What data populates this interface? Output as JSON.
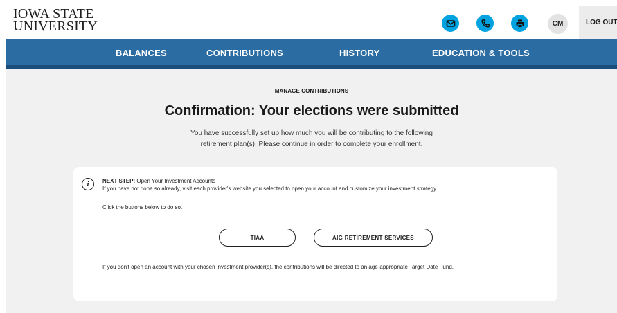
{
  "header": {
    "logo_line1": "IOWA STATE",
    "logo_line2": "UNIVERSITY",
    "icons": [
      "mail-icon",
      "phone-icon",
      "print-icon"
    ],
    "avatar_initials": "CM",
    "logout_label": "LOG OUT",
    "accent_color": "#00a3e0"
  },
  "nav": {
    "items": [
      {
        "label": "BALANCES"
      },
      {
        "label": "CONTRIBUTIONS"
      },
      {
        "label": "HISTORY"
      },
      {
        "label": "EDUCATION & TOOLS"
      }
    ],
    "bg_color": "#2b6ca3"
  },
  "main": {
    "eyebrow": "MANAGE CONTRIBUTIONS",
    "headline": "Confirmation: Your elections were submitted",
    "sub_line1": "You have successfully set up how much you will be contributing to the following",
    "sub_line2": "retirement plan(s). Please continue in order to complete your enrollment."
  },
  "card": {
    "next_step_label": "NEXT STEP:",
    "next_step_title": "Open Your Investment Accounts",
    "body": "If you have not done so already, visit each provider's website you selected to open your account and customize your investment strategy.",
    "click_text": "Click the buttons below to do so.",
    "buttons": [
      {
        "label": "TIAA"
      },
      {
        "label": "AIG RETIREMENT SERVICES"
      }
    ],
    "footnote": "If you don't open an account with your chosen investment provider(s), the contributions will be directed to an age-appropriate Target Date Fund."
  }
}
